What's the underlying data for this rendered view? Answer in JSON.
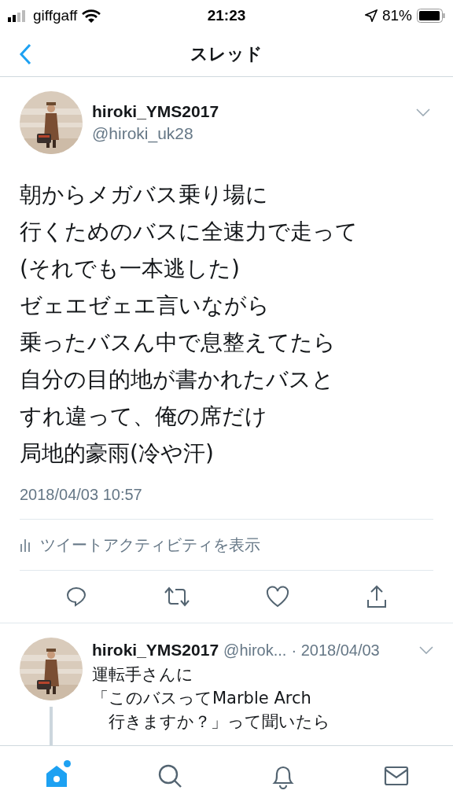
{
  "status_bar": {
    "carrier": "giffgaff",
    "time": "21:23",
    "battery": "81%"
  },
  "nav": {
    "title": "スレッド"
  },
  "tweet": {
    "name": "hiroki_YMS2017",
    "handle": "@hiroki_uk28",
    "lines": [
      "朝からメガバス乗り場に",
      "行くためのバスに全速力で走って",
      "(それでも一本逃した)",
      "ゼェエゼェエ言いながら",
      "乗ったバスん中で息整えてたら",
      "自分の目的地が書かれたバスと",
      "すれ違って、俺の席だけ",
      "局地的豪雨(冷や汗)"
    ],
    "timestamp": "2018/04/03 10:57",
    "activity": "ツイートアクティビティを表示"
  },
  "reply": {
    "name": "hiroki_YMS2017",
    "handle": "@hirok...",
    "date": "· 2018/04/03",
    "lines": [
      "運転手さんに",
      "「このバスってMarble Arch",
      "　行きますか？」って聞いたら"
    ]
  },
  "tab_bar": [
    {
      "kind": "home",
      "selected": true,
      "badge": true
    },
    {
      "kind": "search",
      "selected": false,
      "badge": false
    },
    {
      "kind": "notifications",
      "selected": false,
      "badge": false
    },
    {
      "kind": "messages",
      "selected": false,
      "badge": false
    }
  ]
}
